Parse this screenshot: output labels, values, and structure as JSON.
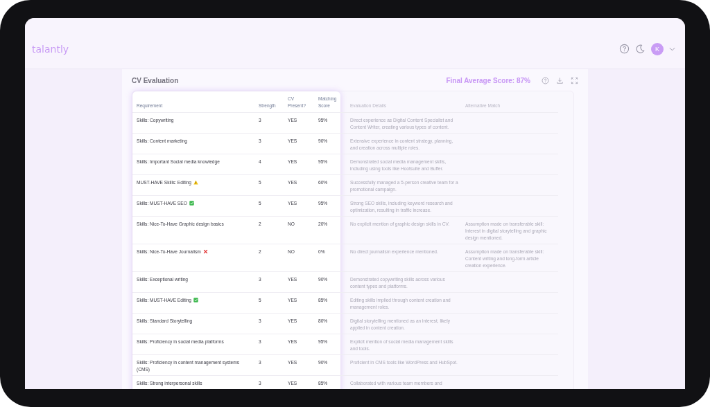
{
  "header": {
    "logo": "talantly",
    "avatar": "K"
  },
  "panel": {
    "title": "CV Evaluation",
    "score": "Final Average Score: 87%"
  },
  "table": {
    "columns": [
      "Requirement",
      "Strength",
      "CV Present?",
      "Matching Score",
      "Evaluation Details",
      "Alternative Match"
    ],
    "rows": [
      {
        "kind": "plain",
        "requirement": "Skills: Copywriting",
        "strength": "3",
        "cv_present": "YES",
        "score": "95%",
        "details": "Direct experience as Digital Content Specialist and Content Writer, creating various types of content."
      },
      {
        "kind": "plain",
        "requirement": "Skills: Content marketing",
        "strength": "3",
        "cv_present": "YES",
        "score": "90%",
        "details": "Extensive experience in content strategy, planning, and creation across multiple roles."
      },
      {
        "kind": "plain",
        "requirement": "Skills: Important Social media knowledge",
        "strength": "4",
        "cv_present": "YES",
        "score": "95%",
        "details": "Demonstrated social media management skills, including using tools like Hootsuite and Buffer."
      },
      {
        "kind": "warning",
        "requirement": "MUST-HAVE Skills: Editing",
        "strength": "5",
        "cv_present": "YES",
        "score": "60%",
        "details": "Successfully managed a 5-person creative team for a promotional campaign."
      },
      {
        "kind": "check",
        "requirement": "Skills: MUST-HAVE SEO",
        "strength": "5",
        "cv_present": "YES",
        "score": "95%",
        "details": "Strong SEO skills, including keyword research and optimization, resulting in traffic increase."
      },
      {
        "kind": "plain",
        "requirement": "Skills: Nice-To-Have Graphic design basics",
        "strength": "2",
        "cv_present": "NO",
        "score": "20%",
        "details": "No explicit mention of graphic design skills in CV.",
        "alternative": "Assumption made on transferable skill: Interest in digital storytelling and graphic design mentioned."
      },
      {
        "kind": "cross",
        "requirement": "Skills: Nice-To-Have Journalism",
        "strength": "2",
        "cv_present": "NO",
        "score": "0%",
        "details": "No direct journalism experience mentioned.",
        "alternative": "Assumption made on transferable skill: Content writing and long-form article creation experience."
      },
      {
        "kind": "plain",
        "requirement": "Skills: Exceptional writing",
        "strength": "3",
        "cv_present": "YES",
        "score": "90%",
        "details": "Demonstrated copywriting skills across various content types and platforms."
      },
      {
        "kind": "check",
        "requirement": "Skills: MUST-HAVE Editing",
        "strength": "5",
        "cv_present": "YES",
        "score": "85%",
        "details": "Editing skills implied through content creation and management roles."
      },
      {
        "kind": "plain",
        "requirement": "Skills: Standard Storytelling",
        "strength": "3",
        "cv_present": "YES",
        "score": "80%",
        "details": "Digital storytelling mentioned as an interest, likely applied in content creation."
      },
      {
        "kind": "plain",
        "requirement": "Skills: Proficiency in social media platforms",
        "strength": "3",
        "cv_present": "YES",
        "score": "95%",
        "details": "Explicit mention of social media management skills and tools."
      },
      {
        "kind": "plain",
        "requirement": "Skills: Proficiency in content management systems (CMS)",
        "strength": "3",
        "cv_present": "YES",
        "score": "90%",
        "details": "Proficient in CMS tools like WordPress and HubSpot."
      },
      {
        "kind": "plain",
        "requirement": "Skills: Strong interpersonal skills",
        "strength": "3",
        "cv_present": "YES",
        "score": "85%",
        "details": "Collaborated with various team members and"
      }
    ]
  }
}
